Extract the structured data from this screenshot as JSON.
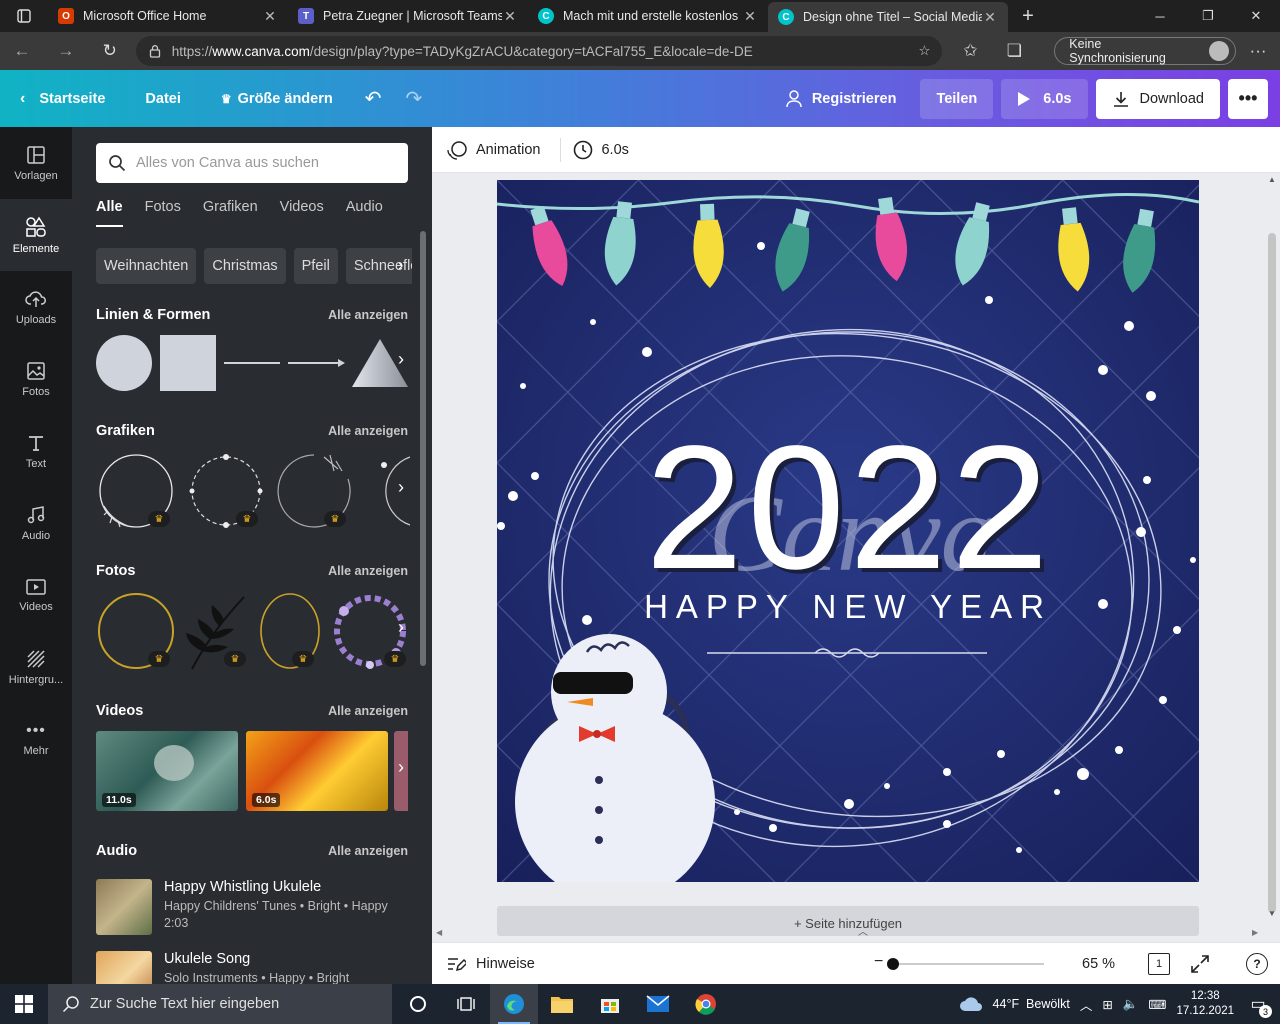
{
  "browser": {
    "tabs": [
      {
        "title": "Microsoft Office Home",
        "icon": "office-icon",
        "color": "#d83b01",
        "active": false
      },
      {
        "title": "Petra Zuegner | Microsoft Teams",
        "icon": "teams-icon",
        "color": "#5b5fc7",
        "active": false
      },
      {
        "title": "Mach mit und erstelle kostenlos",
        "icon": "canva-icon",
        "color": "#00c4cc",
        "active": false
      },
      {
        "title": "Design ohne Titel – Social Media",
        "icon": "canva-icon",
        "color": "#00c4cc",
        "active": true
      }
    ],
    "url_prefix": "https://",
    "url_host": "www.canva.com",
    "url_path": "/design/play?type=TADyKgZrACU&category=tACFal755_E&locale=de-DE",
    "sync_label": "Keine Synchronisierung"
  },
  "header": {
    "home": "Startseite",
    "file": "Datei",
    "resize": "Größe ändern",
    "register": "Registrieren",
    "share": "Teilen",
    "play_duration": "6.0s",
    "download": "Download"
  },
  "rail": [
    {
      "label": "Vorlagen",
      "icon": "templates-icon",
      "active": false
    },
    {
      "label": "Elemente",
      "icon": "elements-icon",
      "active": true
    },
    {
      "label": "Uploads",
      "icon": "upload-icon",
      "active": false
    },
    {
      "label": "Fotos",
      "icon": "photos-icon",
      "active": false
    },
    {
      "label": "Text",
      "icon": "text-icon",
      "active": false
    },
    {
      "label": "Audio",
      "icon": "music-icon",
      "active": false
    },
    {
      "label": "Videos",
      "icon": "video-icon",
      "active": false
    },
    {
      "label": "Hintergru...",
      "icon": "background-icon",
      "active": false
    },
    {
      "label": "Mehr",
      "icon": "more-icon",
      "active": false
    }
  ],
  "panel": {
    "search_placeholder": "Alles von Canva aus suchen",
    "tabs": [
      "Alle",
      "Fotos",
      "Grafiken",
      "Videos",
      "Audio"
    ],
    "chips": [
      "Weihnachten",
      "Christmas",
      "Pfeil",
      "Schneeflocke"
    ],
    "see_all": "Alle anzeigen",
    "sections": {
      "shapes": "Linien & Formen",
      "graphics": "Grafiken",
      "photos": "Fotos",
      "videos": "Videos",
      "audio": "Audio"
    },
    "videos": [
      {
        "duration": "11.0s"
      },
      {
        "duration": "6.0s"
      }
    ],
    "audio": [
      {
        "title": "Happy Whistling Ukulele",
        "meta": "Happy Childrens' Tunes • Bright • Happy",
        "duration": "2:03"
      },
      {
        "title": "Ukulele Song",
        "meta": "Solo Instruments • Happy • Bright",
        "duration": ""
      }
    ]
  },
  "editor": {
    "animation": "Animation",
    "duration": "6.0s",
    "design": {
      "year": "2022",
      "subtitle": "HAPPY NEW YEAR",
      "watermark": "Canva",
      "background": "#1f2a6b"
    },
    "add_page": "+ Seite hinzufügen",
    "notes": "Hinweise",
    "zoom": "65 %",
    "page_count": "1"
  },
  "taskbar": {
    "search_placeholder": "Zur Suche Text hier eingeben",
    "weather": "44°F  Bewölkt",
    "time": "12:38",
    "date": "17.12.2021",
    "notifications": "3"
  }
}
